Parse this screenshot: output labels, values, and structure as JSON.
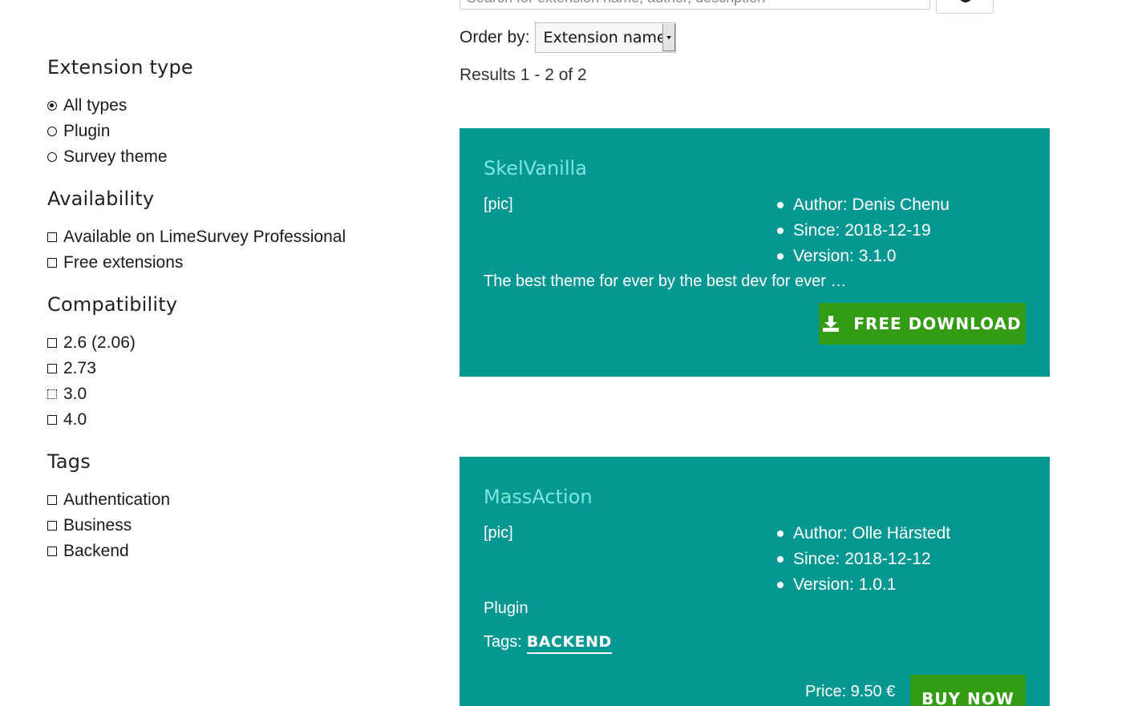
{
  "search": {
    "placeholder": "Search for extension name, author, description",
    "button_icon": "search-icon"
  },
  "order": {
    "label": "Order by:",
    "selected": "Extension name"
  },
  "results_text": "Results 1 - 2 of 2",
  "filters": {
    "extension_type": {
      "title": "Extension type",
      "options": [
        "All types",
        "Plugin",
        "Survey theme"
      ],
      "selected": "All types"
    },
    "availability": {
      "title": "Availability",
      "options": [
        "Available on LimeSurvey Professional",
        "Free extensions"
      ]
    },
    "compatibility": {
      "title": "Compatibility",
      "options": [
        "2.6 (2.06)",
        "2.73",
        "3.0",
        "4.0"
      ]
    },
    "tags": {
      "title": "Tags",
      "options": [
        "Authentication",
        "Business",
        "Backend"
      ]
    }
  },
  "extensions": [
    {
      "name": "SkelVanilla",
      "pic": "[pic]",
      "author": "Author: Denis Chenu",
      "since": "Since: 2018-12-19",
      "version": "Version: 3.1.0",
      "description": "The best theme for ever by the best dev for ever …",
      "action_label": "FREE DOWNLOAD",
      "action_icon": "download-icon"
    },
    {
      "name": "MassAction",
      "pic": "[pic]",
      "author": "Author: Olle Härstedt",
      "since": "Since: 2018-12-12",
      "version": "Version: 1.0.1",
      "type": "Plugin",
      "tags_label": "Tags:",
      "tags": [
        "BACKEND"
      ],
      "price": "Price: 9.50 €",
      "action_label": "BUY NOW"
    }
  ],
  "colors": {
    "card_bg": "#059893",
    "card_title": "#7ce6df",
    "button_green": "#339c14"
  }
}
